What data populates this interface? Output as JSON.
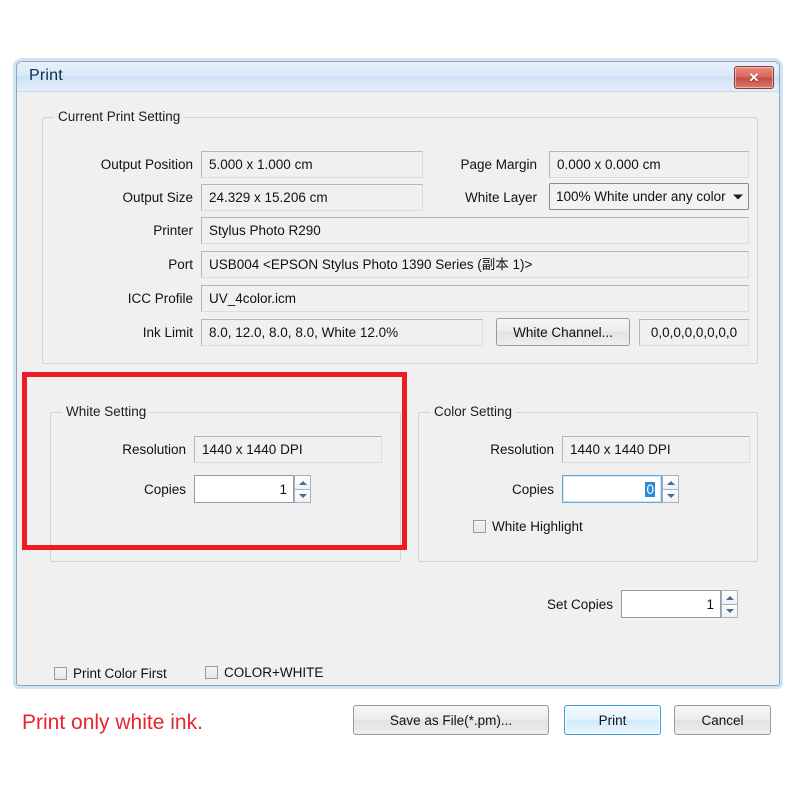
{
  "window": {
    "title": "Print",
    "close_icon": "close-icon",
    "close_label": "✕"
  },
  "current_print_setting": {
    "legend": "Current Print Setting",
    "rows_left": [
      {
        "label": "Output Position",
        "value": "5.000 x 1.000 cm"
      },
      {
        "label": "Output Size",
        "value": "24.329 x 15.206 cm"
      },
      {
        "label": "Printer",
        "value": "Stylus Photo R290"
      },
      {
        "label": "Port",
        "value": "USB004  <EPSON Stylus Photo 1390 Series (副本 1)>"
      },
      {
        "label": "ICC Profile",
        "value": "UV_4color.icm"
      },
      {
        "label": "Ink Limit",
        "value": "8.0, 12.0, 8.0, 8.0, White 12.0%"
      }
    ],
    "page_margin": {
      "label": "Page Margin",
      "value": "0.000 x 0.000 cm"
    },
    "white_layer": {
      "label": "White Layer",
      "value": "100% White under any color",
      "arrow_icon": "chevron-down-icon"
    },
    "white_channel": {
      "button_label": "White Channel...",
      "value": "0,0,0,0,0,0,0,0"
    }
  },
  "white_setting": {
    "legend": "White Setting",
    "resolution": {
      "label": "Resolution",
      "value": "1440 x 1440 DPI"
    },
    "copies": {
      "label": "Copies",
      "value": "1"
    }
  },
  "color_setting": {
    "legend": "Color Setting",
    "resolution": {
      "label": "Resolution",
      "value": "1440 x 1440 DPI"
    },
    "copies": {
      "label": "Copies",
      "value": "0",
      "selected": true
    },
    "white_highlight": {
      "label": "White Highlight",
      "checked": false
    }
  },
  "set_copies": {
    "label": "Set Copies",
    "value": "1"
  },
  "options": {
    "print_color_first": {
      "label": "Print Color First",
      "checked": false
    },
    "color_plus_white": {
      "label": "COLOR+WHITE",
      "checked": false
    }
  },
  "buttons": {
    "save_as_file": "Save as File(*.pm)...",
    "print": "Print",
    "cancel": "Cancel"
  },
  "annotation": {
    "caption": "Print only white ink.",
    "highlight_color": "#ed1c24"
  }
}
